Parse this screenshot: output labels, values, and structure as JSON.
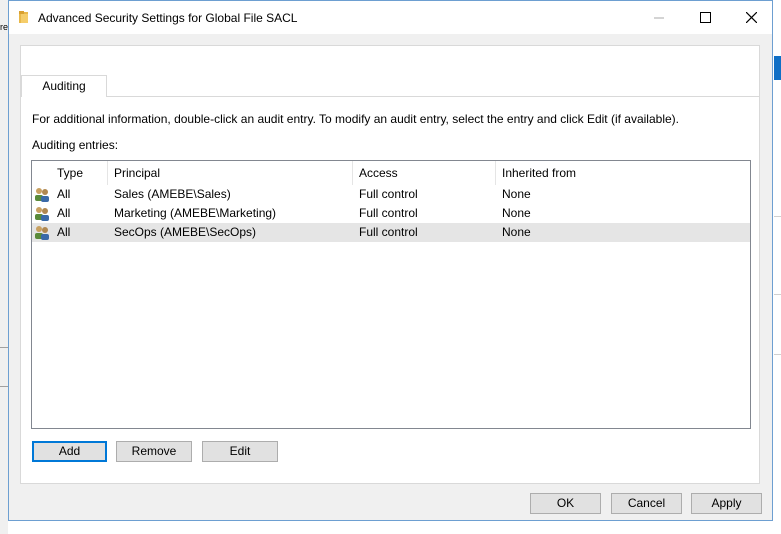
{
  "window": {
    "title": "Advanced Security Settings for Global File SACL"
  },
  "background": {
    "left_fragment": "re"
  },
  "tabs": [
    {
      "label": "Auditing",
      "selected": true
    }
  ],
  "info_text": "For additional information, double-click an audit entry. To modify an audit entry, select the entry and click Edit (if available).",
  "entries_label": "Auditing entries:",
  "table": {
    "columns": [
      "Type",
      "Principal",
      "Access",
      "Inherited from"
    ],
    "rows": [
      {
        "icon": "user-group-icon",
        "type": "All",
        "principal": "Sales (AMEBE\\Sales)",
        "access": "Full control",
        "inherited": "None",
        "selected": false
      },
      {
        "icon": "user-group-icon",
        "type": "All",
        "principal": "Marketing (AMEBE\\Marketing)",
        "access": "Full control",
        "inherited": "None",
        "selected": false
      },
      {
        "icon": "user-group-icon",
        "type": "All",
        "principal": "SecOps (AMEBE\\SecOps)",
        "access": "Full control",
        "inherited": "None",
        "selected": true
      }
    ]
  },
  "buttons": {
    "add": "Add",
    "remove": "Remove",
    "edit": "Edit",
    "ok": "OK",
    "cancel": "Cancel",
    "apply": "Apply"
  },
  "colors": {
    "window_border": "#6d9fd1",
    "accent": "#0078d7",
    "selection": "#e5e5e5"
  }
}
